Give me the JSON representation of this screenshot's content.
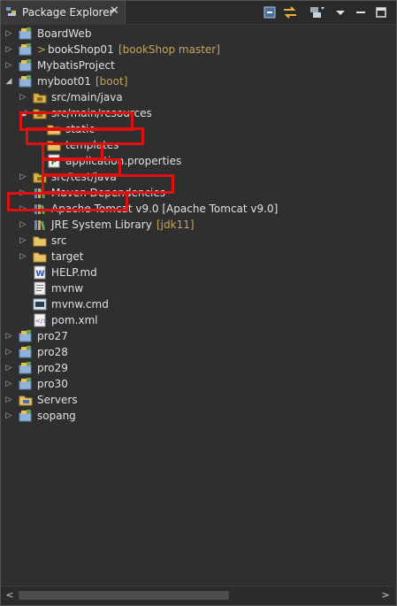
{
  "view": {
    "title": "Package Explorer",
    "toolbar": [
      "collapse-all-icon",
      "link-with-editor-icon",
      "filters-icon",
      "view-menu-icon",
      "minimize-icon",
      "maximize-icon"
    ]
  },
  "tree": [
    {
      "label": "BoardWeb",
      "decoration": "",
      "prefix": "",
      "expanded": false,
      "icon": "project-icon"
    },
    {
      "label": "bookShop01",
      "decoration": "[bookShop master]",
      "prefix": ">",
      "expanded": false,
      "icon": "project-icon"
    },
    {
      "label": "MybatisProject",
      "decoration": "",
      "prefix": "",
      "expanded": false,
      "icon": "project-icon"
    },
    {
      "label": "myboot01",
      "decoration": "[boot]",
      "prefix": "",
      "expanded": true,
      "icon": "project-icon"
    },
    {
      "label": "src/main/java",
      "decoration": "",
      "prefix": "",
      "expanded": false,
      "icon": "source-folder-icon"
    },
    {
      "label": "src/main/resources",
      "decoration": "",
      "prefix": "",
      "expanded": true,
      "icon": "source-folder-icon"
    },
    {
      "label": "static",
      "decoration": "",
      "prefix": "",
      "expanded": null,
      "icon": "folder-icon"
    },
    {
      "label": "templates",
      "decoration": "",
      "prefix": "",
      "expanded": null,
      "icon": "folder-icon"
    },
    {
      "label": "application.properties",
      "decoration": "",
      "prefix": "",
      "expanded": null,
      "icon": "properties-file-icon"
    },
    {
      "label": "src/test/java",
      "decoration": "",
      "prefix": "",
      "expanded": false,
      "icon": "source-folder-icon"
    },
    {
      "label": "Maven Dependencies",
      "decoration": "",
      "prefix": "",
      "expanded": false,
      "icon": "library-icon"
    },
    {
      "label": "Apache Tomcat v9.0 [Apache Tomcat v9.0]",
      "decoration": "",
      "prefix": "",
      "expanded": false,
      "icon": "library-icon"
    },
    {
      "label": "JRE System Library",
      "decoration": "[jdk11]",
      "prefix": "",
      "expanded": false,
      "icon": "library-icon"
    },
    {
      "label": "src",
      "decoration": "",
      "prefix": "",
      "expanded": false,
      "icon": "folder-icon"
    },
    {
      "label": "target",
      "decoration": "",
      "prefix": "",
      "expanded": false,
      "icon": "folder-icon"
    },
    {
      "label": "HELP.md",
      "decoration": "",
      "prefix": "",
      "expanded": null,
      "icon": "markdown-file-icon"
    },
    {
      "label": "mvnw",
      "decoration": "",
      "prefix": "",
      "expanded": null,
      "icon": "text-file-icon"
    },
    {
      "label": "mvnw.cmd",
      "decoration": "",
      "prefix": "",
      "expanded": null,
      "icon": "cmd-file-icon"
    },
    {
      "label": "pom.xml",
      "decoration": "",
      "prefix": "",
      "expanded": null,
      "icon": "xml-file-icon"
    },
    {
      "label": "pro27",
      "decoration": "",
      "prefix": "",
      "expanded": false,
      "icon": "project-icon"
    },
    {
      "label": "pro28",
      "decoration": "",
      "prefix": "",
      "expanded": false,
      "icon": "project-icon"
    },
    {
      "label": "pro29",
      "decoration": "",
      "prefix": "",
      "expanded": false,
      "icon": "project-icon"
    },
    {
      "label": "pro30",
      "decoration": "",
      "prefix": "",
      "expanded": false,
      "icon": "project-icon"
    },
    {
      "label": "Servers",
      "decoration": "",
      "prefix": "",
      "expanded": false,
      "icon": "servers-folder-icon"
    },
    {
      "label": "sopang",
      "decoration": "",
      "prefix": "",
      "expanded": false,
      "icon": "project-icon"
    }
  ],
  "colors": {
    "highlight": "#e01010",
    "decoration": "#c8a55a",
    "background": "#2f2f2f"
  }
}
